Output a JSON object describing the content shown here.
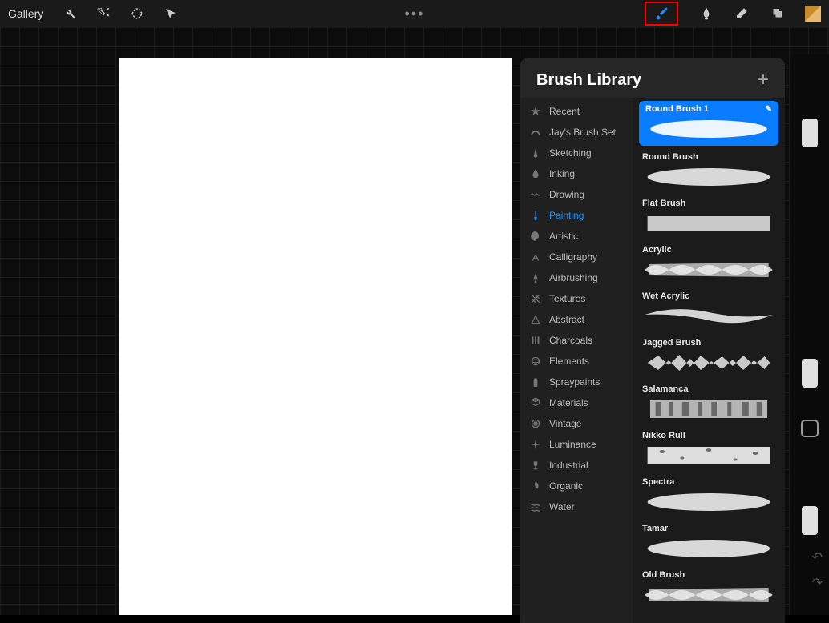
{
  "topbar": {
    "gallery_label": "Gallery",
    "more_icon": "•••"
  },
  "brush_panel": {
    "title": "Brush Library",
    "categories": [
      {
        "label": "Recent",
        "icon": "star"
      },
      {
        "label": "Jay's Brush Set",
        "icon": "stroke"
      },
      {
        "label": "Sketching",
        "icon": "pencil"
      },
      {
        "label": "Inking",
        "icon": "drop"
      },
      {
        "label": "Drawing",
        "icon": "squiggle"
      },
      {
        "label": "Painting",
        "icon": "brush",
        "active": true
      },
      {
        "label": "Artistic",
        "icon": "palette"
      },
      {
        "label": "Calligraphy",
        "icon": "a"
      },
      {
        "label": "Airbrushing",
        "icon": "spray"
      },
      {
        "label": "Textures",
        "icon": "texture"
      },
      {
        "label": "Abstract",
        "icon": "triangle"
      },
      {
        "label": "Charcoals",
        "icon": "lines"
      },
      {
        "label": "Elements",
        "icon": "sphere"
      },
      {
        "label": "Spraypaints",
        "icon": "can"
      },
      {
        "label": "Materials",
        "icon": "cube"
      },
      {
        "label": "Vintage",
        "icon": "asterisk"
      },
      {
        "label": "Luminance",
        "icon": "sparkle"
      },
      {
        "label": "Industrial",
        "icon": "trophy"
      },
      {
        "label": "Organic",
        "icon": "leaf"
      },
      {
        "label": "Water",
        "icon": "waves"
      }
    ],
    "brushes": [
      {
        "name": "Round Brush 1",
        "selected": true,
        "stroke": "soft"
      },
      {
        "name": "Round Brush",
        "stroke": "soft"
      },
      {
        "name": "Flat Brush",
        "stroke": "flat"
      },
      {
        "name": "Acrylic",
        "stroke": "rough"
      },
      {
        "name": "Wet Acrylic",
        "stroke": "wet"
      },
      {
        "name": "Jagged Brush",
        "stroke": "jagged"
      },
      {
        "name": "Salamanca",
        "stroke": "dry"
      },
      {
        "name": "Nikko Rull",
        "stroke": "grain"
      },
      {
        "name": "Spectra",
        "stroke": "soft"
      },
      {
        "name": "Tamar",
        "stroke": "soft"
      },
      {
        "name": "Old Brush",
        "stroke": "rough"
      }
    ]
  }
}
